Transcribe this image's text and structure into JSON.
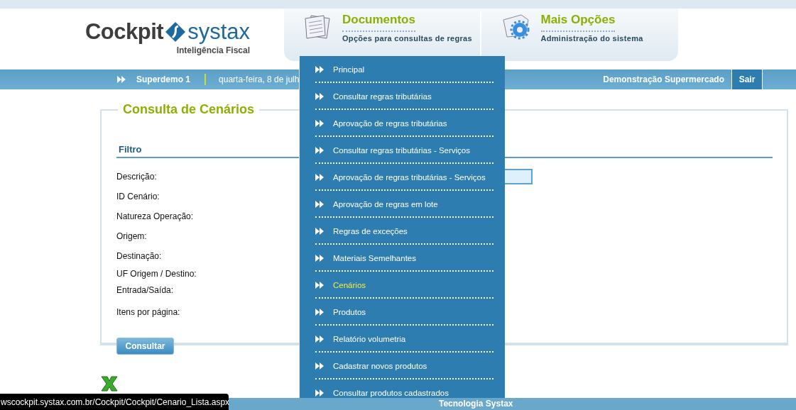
{
  "logo": {
    "brand_left": "Cockpit",
    "brand_right": "systax",
    "tagline": "Inteligência Fiscal"
  },
  "nav_tabs": [
    {
      "title": "Documentos",
      "subtitle": "Opções para consultas de regras",
      "expanded": true
    },
    {
      "title": "Mais Opções",
      "subtitle": "Administração do sistema",
      "expanded": false
    }
  ],
  "user_bar": {
    "user": "Superdemo 1",
    "date": "quarta-feira, 8 de julh",
    "company": "Demonstração Supermercado",
    "logout": "Sair"
  },
  "menu": [
    {
      "label": "Principal",
      "selected": false
    },
    {
      "label": "Consultar regras tributárias",
      "selected": false
    },
    {
      "label": "Aprovação de regras tributárias",
      "selected": false
    },
    {
      "label": "Consultar regras tributárias - Serviços",
      "selected": false
    },
    {
      "label": "Aprovação de regras tributárias - Serviços",
      "selected": false
    },
    {
      "label": "Aprovação de regras em lote",
      "selected": false
    },
    {
      "label": "Regras de exceções",
      "selected": false
    },
    {
      "label": "Materiais Semelhantes",
      "selected": false
    },
    {
      "label": "Cenários",
      "selected": true
    },
    {
      "label": "Produtos",
      "selected": false
    },
    {
      "label": "Relatório volumetria",
      "selected": false
    },
    {
      "label": "Cadastrar novos produtos",
      "selected": false
    },
    {
      "label": "Consultar produtos cadastrados",
      "selected": false
    }
  ],
  "panel": {
    "title": "Consulta de Cenários",
    "section": "Filtro",
    "fields": [
      {
        "label": "Descrição:",
        "kind": "text"
      },
      {
        "label": "ID Cenário:",
        "kind": "label"
      },
      {
        "label": "Natureza Operação:",
        "kind": "label"
      },
      {
        "label": "Origem:",
        "kind": "label"
      },
      {
        "label": "Destinação:",
        "kind": "label"
      },
      {
        "label": "UF Origem / Destino:",
        "kind": "label"
      },
      {
        "label": "Entrada/Saída:",
        "kind": "label"
      },
      {
        "label": "Itens por página:",
        "kind": "label"
      }
    ],
    "button": "Consultar"
  },
  "footer": "Tecnologia Systax",
  "status_url": "wscockpit.systax.com.br/Cockpit/Cockpit/Cenario_Lista.aspx"
}
